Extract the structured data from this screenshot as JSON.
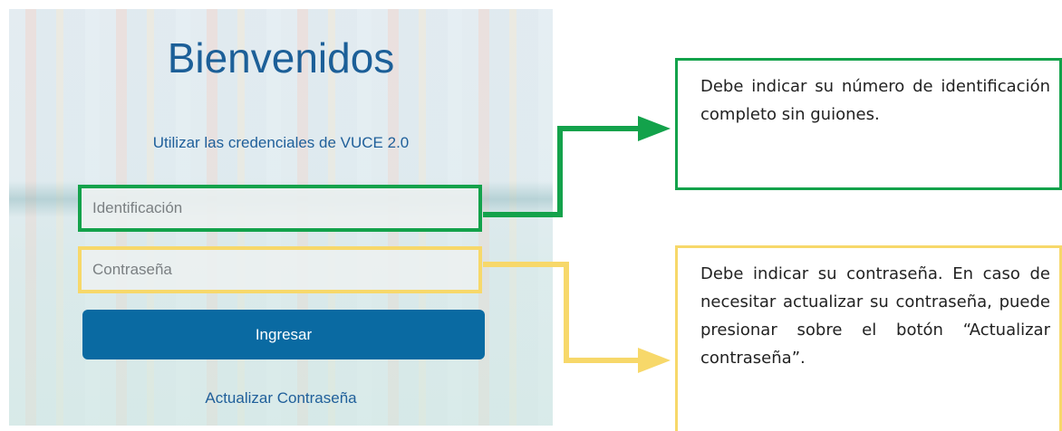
{
  "login": {
    "title": "Bienvenidos",
    "subtitle": "Utilizar las credenciales de VUCE 2.0",
    "id_placeholder": "Identificación",
    "password_placeholder": "Contraseña",
    "submit_label": "Ingresar",
    "update_password_label": "Actualizar Contraseña"
  },
  "annotations": {
    "id_note": "Debe indicar su número de identificación completo sin guiones.",
    "password_note": "Debe indicar su contraseña. En caso de necesitar actualizar su contraseña, puede presionar sobre el botón “Actualizar contraseña”."
  },
  "colors": {
    "brand_blue": "#0a6aa2",
    "title_blue": "#1c5f98",
    "highlight_green": "#13a24b",
    "highlight_yellow": "#f7d86a"
  }
}
